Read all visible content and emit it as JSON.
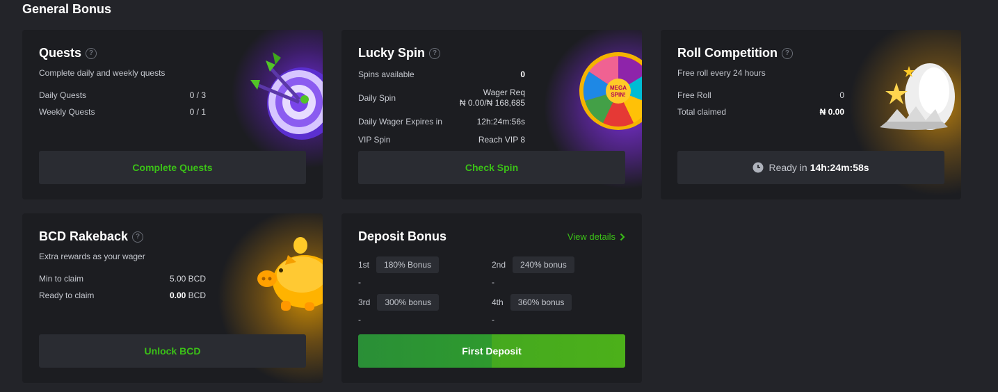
{
  "section_title": "General Bonus",
  "quests": {
    "title": "Quests",
    "subtitle": "Complete daily and weekly quests",
    "rows": [
      {
        "label": "Daily Quests",
        "value": "0 / 3"
      },
      {
        "label": "Weekly Quests",
        "value": "0 / 1"
      }
    ],
    "button": "Complete Quests"
  },
  "lucky_spin": {
    "title": "Lucky Spin",
    "spins_label": "Spins available",
    "spins_value": "0",
    "daily_label": "Daily Spin",
    "wager_req_label": "Wager Req",
    "wager_req_value": "₦ 0.00/₦ 168,685",
    "expires_label": "Daily Wager Expires in",
    "expires_value": "12h:24m:56s",
    "vip_label": "VIP Spin",
    "vip_value": "Reach VIP 8",
    "wheel_text": "MEGA SPIN!",
    "button": "Check Spin"
  },
  "roll": {
    "title": "Roll Competition",
    "subtitle": "Free roll every 24 hours",
    "free_roll_label": "Free Roll",
    "free_roll_value": "0",
    "total_label": "Total claimed",
    "total_value": "₦ 0.00",
    "ready_label": "Ready in",
    "ready_value": "14h:24m:58s"
  },
  "rakeback": {
    "title": "BCD Rakeback",
    "subtitle": "Extra rewards as your wager",
    "min_label": "Min to claim",
    "min_value": "5.00 BCD",
    "ready_label": "Ready to claim",
    "ready_amount": "0.00",
    "ready_unit": "BCD",
    "button": "Unlock BCD"
  },
  "deposit": {
    "title": "Deposit Bonus",
    "view_details": "View details",
    "tiers": [
      {
        "ordinal": "1st",
        "bonus": "180% Bonus",
        "note": "-"
      },
      {
        "ordinal": "2nd",
        "bonus": "240% bonus",
        "note": "-"
      },
      {
        "ordinal": "3rd",
        "bonus": "300% bonus",
        "note": "-"
      },
      {
        "ordinal": "4th",
        "bonus": "360% bonus",
        "note": "-"
      }
    ],
    "button": "First Deposit"
  },
  "colors": {
    "accent_green": "#3bc117",
    "card_bg": "#1c1d21",
    "page_bg": "#232429"
  }
}
